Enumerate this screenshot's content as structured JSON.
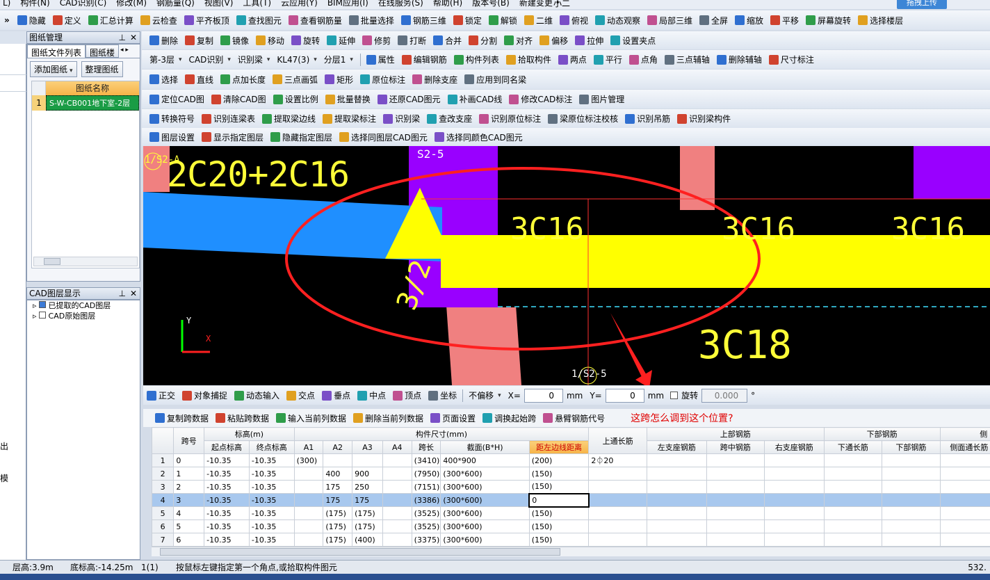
{
  "menubar": {
    "items": [
      "L)",
      "构件(N)",
      "CAD识别(C)",
      "修改(M)",
      "钢筋量(Q)",
      "视图(V)",
      "工具(T)",
      "云应用(Y)",
      "BIM应用(I)",
      "在线服务(S)",
      "帮助(H)",
      "版本号(B)",
      "新建变更 •"
    ],
    "user": "小二",
    "upload_button": "拖拽上传"
  },
  "toolbar1": [
    "隐藏",
    "定义",
    "汇总计算",
    "云检查",
    "平齐板顶",
    "查找图元",
    "查看钢筋量",
    "批量选择",
    "钢筋三维",
    "锁定",
    "解锁",
    "二维",
    "俯视",
    "动态观察",
    "局部三维",
    "全屏",
    "缩放",
    "平移",
    "屏幕旋转",
    "选择楼层"
  ],
  "toolbar2": [
    "删除",
    "复制",
    "镜像",
    "移动",
    "旋转",
    "延伸",
    "修剪",
    "打断",
    "合并",
    "分割",
    "对齐",
    "偏移",
    "拉伸",
    "设置夹点"
  ],
  "toolbar3": {
    "floor": "第-3层",
    "cad": "CAD识别",
    "type": "识别梁",
    "member": "KL47(3)",
    "layer": "分层1",
    "items": [
      "属性",
      "编辑钢筋",
      "构件列表",
      "拾取构件",
      "两点",
      "平行",
      "点角",
      "三点辅轴",
      "删除辅轴",
      "尺寸标注"
    ]
  },
  "toolbar4": [
    "选择",
    "直线",
    "点加长度",
    "三点画弧",
    "矩形",
    "原位标注",
    "删除支座",
    "应用到同名梁"
  ],
  "toolbar5": [
    "定位CAD图",
    "清除CAD图",
    "设置比例",
    "批量替换",
    "还原CAD图元",
    "补画CAD线",
    "修改CAD标注",
    "图片管理"
  ],
  "toolbar6": [
    "转换符号",
    "识别连梁表",
    "提取梁边线",
    "提取梁标注",
    "识别梁",
    "查改支座",
    "识别原位标注",
    "梁原位标注校核",
    "识别吊筋",
    "识别梁构件"
  ],
  "toolbar7": [
    "图层设置",
    "显示指定图层",
    "隐藏指定图层",
    "选择同图层CAD图元",
    "选择同颜色CAD图元"
  ],
  "left_panel": {
    "title": "图纸管理",
    "tabs": [
      "图纸文件列表",
      "图纸楼"
    ],
    "buttons": [
      "添加图纸",
      "整理图纸"
    ],
    "column": "图纸名称",
    "rows": [
      {
        "no": "1",
        "name": "S-W-CB001地下室-2层"
      }
    ],
    "layer_title": "CAD图层显示",
    "layers": [
      "已提取的CAD图层",
      "CAD原始图层"
    ]
  },
  "left_edge": [
    "出",
    "模"
  ],
  "canvas": {
    "labels": [
      "1/S2-A",
      "2C20+2C16",
      "S2-5",
      "3C16",
      "3C16",
      "3C16",
      "3/2",
      "3C18",
      "1/S2-5"
    ],
    "axis_x": "X",
    "axis_y": "Y"
  },
  "snapbar": {
    "items": [
      "正交",
      "对象捕捉",
      "动态输入",
      "交点",
      "垂点",
      "中点",
      "顶点",
      "坐标"
    ],
    "offset": "不偏移",
    "x_label": "X=",
    "x_value": "0",
    "x_unit": "mm",
    "y_label": "Y=",
    "y_value": "0",
    "y_unit": "mm",
    "rotate_label": "旋转",
    "rotate_value": "0.000",
    "degree": "°"
  },
  "grid_toolbar": {
    "items": [
      "复制跨数据",
      "粘贴跨数据",
      "输入当前列数据",
      "删除当前列数据",
      "页面设置",
      "调换起始跨",
      "悬臂钢筋代号"
    ],
    "question": "这跨怎么调到这个位置?"
  },
  "grid": {
    "group_headers": [
      "标高(m)",
      "构件尺寸(mm)",
      "上部钢筋",
      "下部钢筋",
      "侧"
    ],
    "headers": [
      "跨号",
      "起点标高",
      "终点标高",
      "A1",
      "A2",
      "A3",
      "A4",
      "跨长",
      "截面(B*H)",
      "距左边线距离",
      "上通长筋",
      "左支座钢筋",
      "跨中钢筋",
      "右支座钢筋",
      "下通长筋",
      "下部钢筋",
      "侧面通长筋",
      "侧面"
    ],
    "rows": [
      [
        "1",
        "0",
        "-10.35",
        "-10.35",
        "(300)",
        "",
        "",
        "",
        "(3410)",
        "400*900",
        "(200)",
        "2⏀20"
      ],
      [
        "2",
        "1",
        "-10.35",
        "-10.35",
        "",
        "400",
        "900",
        "",
        "(7950)",
        "(300*600)",
        "(150)",
        ""
      ],
      [
        "3",
        "2",
        "-10.35",
        "-10.35",
        "",
        "175",
        "250",
        "",
        "(7151)",
        "(300*600)",
        "(150)",
        ""
      ],
      [
        "4",
        "3",
        "-10.35",
        "-10.35",
        "",
        "175",
        "175",
        "",
        "(3386)",
        "(300*600)",
        "0",
        ""
      ],
      [
        "5",
        "4",
        "-10.35",
        "-10.35",
        "",
        "(175)",
        "(175)",
        "",
        "(3525)",
        "(300*600)",
        "(150)",
        ""
      ],
      [
        "6",
        "5",
        "-10.35",
        "-10.35",
        "",
        "(175)",
        "(175)",
        "",
        "(3525)",
        "(300*600)",
        "(150)",
        ""
      ],
      [
        "7",
        "6",
        "-10.35",
        "-10.35",
        "",
        "(175)",
        "(400)",
        "",
        "(3375)",
        "(300*600)",
        "(150)",
        ""
      ]
    ]
  },
  "statusbar": {
    "floor_height": "层高:3.9m",
    "bottom_elev": "底标高:-14.25m",
    "count": "1(1)",
    "hint": "按鼠标左键指定第一个角点,或拾取构件图元",
    "coord": "532."
  }
}
